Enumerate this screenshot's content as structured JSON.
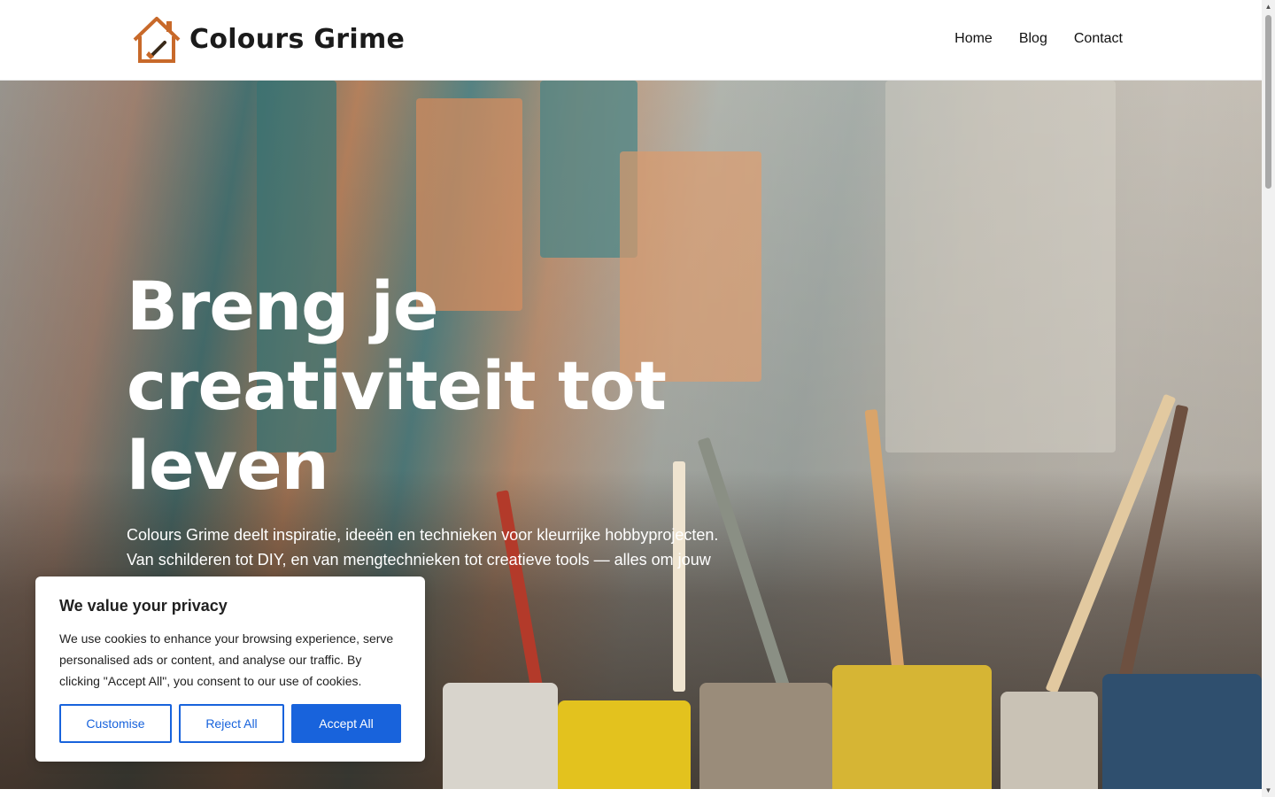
{
  "header": {
    "logo_text": "Colours Grime",
    "nav": [
      {
        "label": "Home"
      },
      {
        "label": "Blog"
      },
      {
        "label": "Contact"
      }
    ]
  },
  "hero": {
    "title": "Breng je creativiteit tot leven",
    "text": "Colours Grime deelt inspiratie, ideeën en technieken voor kleurrijke hobbyprojecten. Van schilderen tot DIY, en van mengtechnieken tot creatieve tools — alles om jouw"
  },
  "cookie_banner": {
    "title": "We value your privacy",
    "body": "We use cookies to enhance your browsing experience, serve personalised ads or content, and analyse our traffic. By clicking \"Accept All\", you consent to our use of cookies.",
    "customise_label": "Customise",
    "reject_label": "Reject All",
    "accept_label": "Accept All"
  },
  "colors": {
    "accent": "#1863dc",
    "logo_orange": "#c8692a"
  }
}
